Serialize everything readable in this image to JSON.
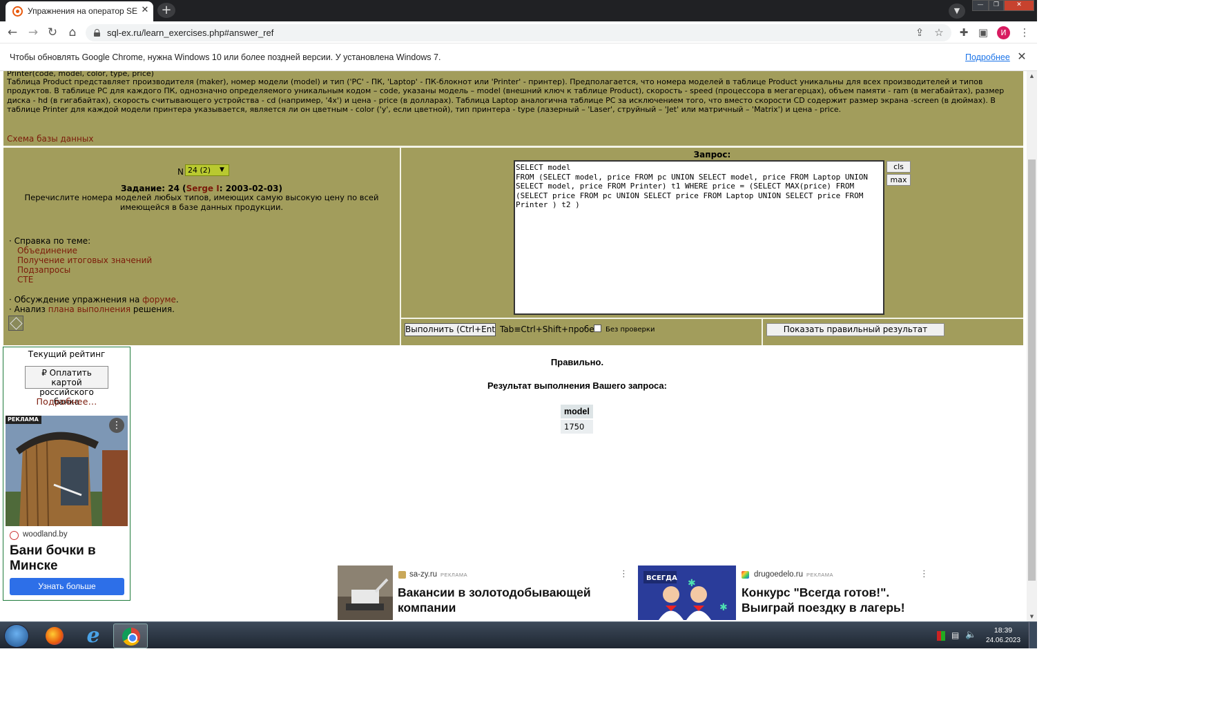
{
  "browser": {
    "tab_title": "Упражнения на оператор SELECT",
    "url": "sql-ex.ru/learn_exercises.php#answer_ref",
    "profile_initial": "И"
  },
  "infobar": {
    "text": "Чтобы обновлять Google Chrome, нужна Windows 10 или более поздней версии. У установлена Windows 7.",
    "link": "Подробнее"
  },
  "description": {
    "schema_line": "Printer(code, model, color, type, price)",
    "text": "Таблица Product представляет производителя (maker), номер модели (model) и тип ('PC' - ПК, 'Laptop' - ПК-блокнот или 'Printer' - принтер). Предполагается, что номера моделей в таблице Product уникальны для всех производителей и типов продуктов. В таблице PC для каждого ПК, однозначно определяемого уникальным кодом – code, указаны модель – model (внешний ключ к таблице Product), скорость - speed (процессора в мегагерцах), объем памяти - ram (в мегабайтах), размер диска - hd (в гигабайтах), скорость считывающего устройства - cd (например, '4x') и цена - price (в долларах). Таблица Laptop аналогична таблице PC за исключением того, что вместо скорости CD содержит размер экрана -screen (в дюймах). В таблице Printer для каждой модели принтера указывается, является ли он цветным - color ('y', если цветной), тип принтера - type (лазерный – 'Laser', струйный – 'Jet' или матричный – 'Matrix') и цена - price.",
    "schema_link": "Схема базы данных"
  },
  "task": {
    "n_label": "N",
    "n_selected": "24 (2)",
    "title_prefix": "Задание: 24 (",
    "author": "Serge I",
    "title_suffix": ": 2003-02-03)",
    "text": "Перечислите номера моделей любых типов, имеющих самую высокую цену по всей имеющейся в базе данных продукции.",
    "help_title": "· Справка по теме:",
    "help_links": [
      "Объединение",
      "Получение итоговых значений",
      "Подзапросы",
      "CTE"
    ],
    "forum_prefix": "· Обсуждение упражнения на ",
    "forum_link": "форуме",
    "forum_suffix": ".",
    "plan_prefix": "· Анализ ",
    "plan_link": "плана выполнения",
    "plan_suffix": " решения."
  },
  "query": {
    "label": "Запрос:",
    "text": "SELECT model\nFROM (SELECT model, price FROM pc UNION SELECT model, price FROM Laptop UNION\nSELECT model, price FROM Printer) t1 WHERE price = (SELECT MAX(price) FROM\n(SELECT price FROM pc UNION SELECT price FROM Laptop UNION SELECT price FROM\nPrinter ) t2 )",
    "cls_label": "cls",
    "max_label": "max",
    "run_label": "Выполнить (Ctrl+Enter)",
    "tab_hint": "Tab≡Ctrl+Shift+пробел",
    "nocheck_label": "Без  проверки",
    "show_result_label": "Показать правильный результат"
  },
  "rating": {
    "title": "Текущий рейтинг",
    "pay_label": "₽ Оплатить картой российского банка",
    "more_label": "Подробнее..."
  },
  "result": {
    "status": "Правильно.",
    "title": "Результат выполнения Вашего запроса:",
    "columns": [
      "model"
    ],
    "rows": [
      [
        "1750"
      ]
    ]
  },
  "ads": {
    "side": {
      "badge": "РЕКЛАМА",
      "domain": "woodland.by",
      "title": "Бани бочки в Минске",
      "button": "Узнать больше"
    },
    "bottom": [
      {
        "domain": "sa-zy.ru",
        "tag": "РЕКЛАМА",
        "title": "Вакансии в золотодобывающей компании"
      },
      {
        "domain": "drugoedelo.ru",
        "tag": "РЕКЛАМА",
        "title": "Конкурс \"Всегда готов!\". Выиграй поездку в лагерь!"
      }
    ]
  },
  "taskbar": {
    "time": "18:39",
    "date": "24.06.2023"
  }
}
